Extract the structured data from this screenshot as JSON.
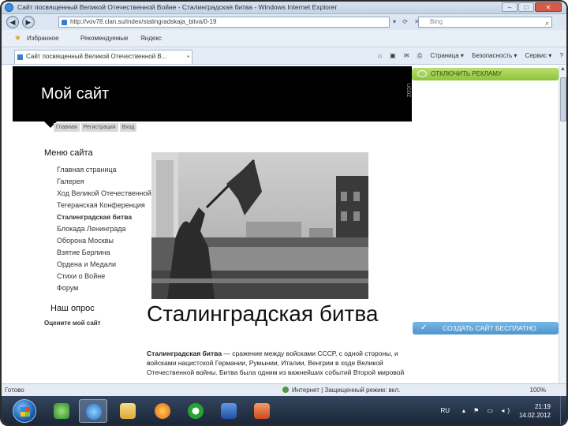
{
  "window": {
    "title": "Сайт посвященный Великой Отечественной Войне - Сталинградская битва - Windows Internet Explorer",
    "controls": [
      "–",
      "□",
      "✕"
    ]
  },
  "addressbar": {
    "url": "http://vov78.clan.su/index/stalingradskaja_bitva/0-19",
    "search_placeholder": "Bing"
  },
  "favorites_bar": {
    "favorites_label": "Избранное",
    "suggested_label": "Рекомендуемые",
    "yandex_label": "Яндекс"
  },
  "tab": {
    "title": "Сайт посвященный Великой Отечественной В..."
  },
  "commandbar": {
    "page": "Страница ▾",
    "safety": "Безопасность ▾",
    "service": "Сервис ▾",
    "help": "?"
  },
  "site": {
    "title": "Мой сайт",
    "ad_label": "ОТКЛЮЧИТЬ РЕКЛАМУ",
    "create_label": "СОЗДАТЬ САЙТ БЕСПЛАТНО",
    "top_menu": [
      "Главная",
      "Регистрация",
      "Вход"
    ]
  },
  "sidebar": {
    "menu_title": "Меню сайта",
    "items": [
      "Главная страница",
      "Галерея",
      "Ход Великой Отечественной",
      "Тегеранская Конференция",
      "Сталинградская битва",
      "Блокада Ленинграда",
      "Оборона Москвы",
      "Взятие Берлина",
      "Ордена и Медали",
      "Стихи о Войне",
      "Форум"
    ],
    "poll_title": "Наш опрос",
    "poll_question": "Оцените мой сайт"
  },
  "article": {
    "title": "Сталинградская битва",
    "lead": "Сталинградская битва",
    "text": " — сражение между войсками СССР, с одной стороны, и войсками нацистской Германии, Румынии, Италии, Венгрии в ходе Великой Отечественной войны. Битва была одним из важнейших событий Второй мировой"
  },
  "statusbar": {
    "ready": "Готово",
    "zone": "Интернет | Защищенный режим: вкл.",
    "zoom": "100%"
  },
  "taskbar": {
    "lang": "RU",
    "time": "21:19",
    "date": "14.02.2012"
  },
  "colors": {
    "ad_green": "#8cc43a",
    "create_blue": "#4e95cd",
    "header_black": "#000000"
  }
}
